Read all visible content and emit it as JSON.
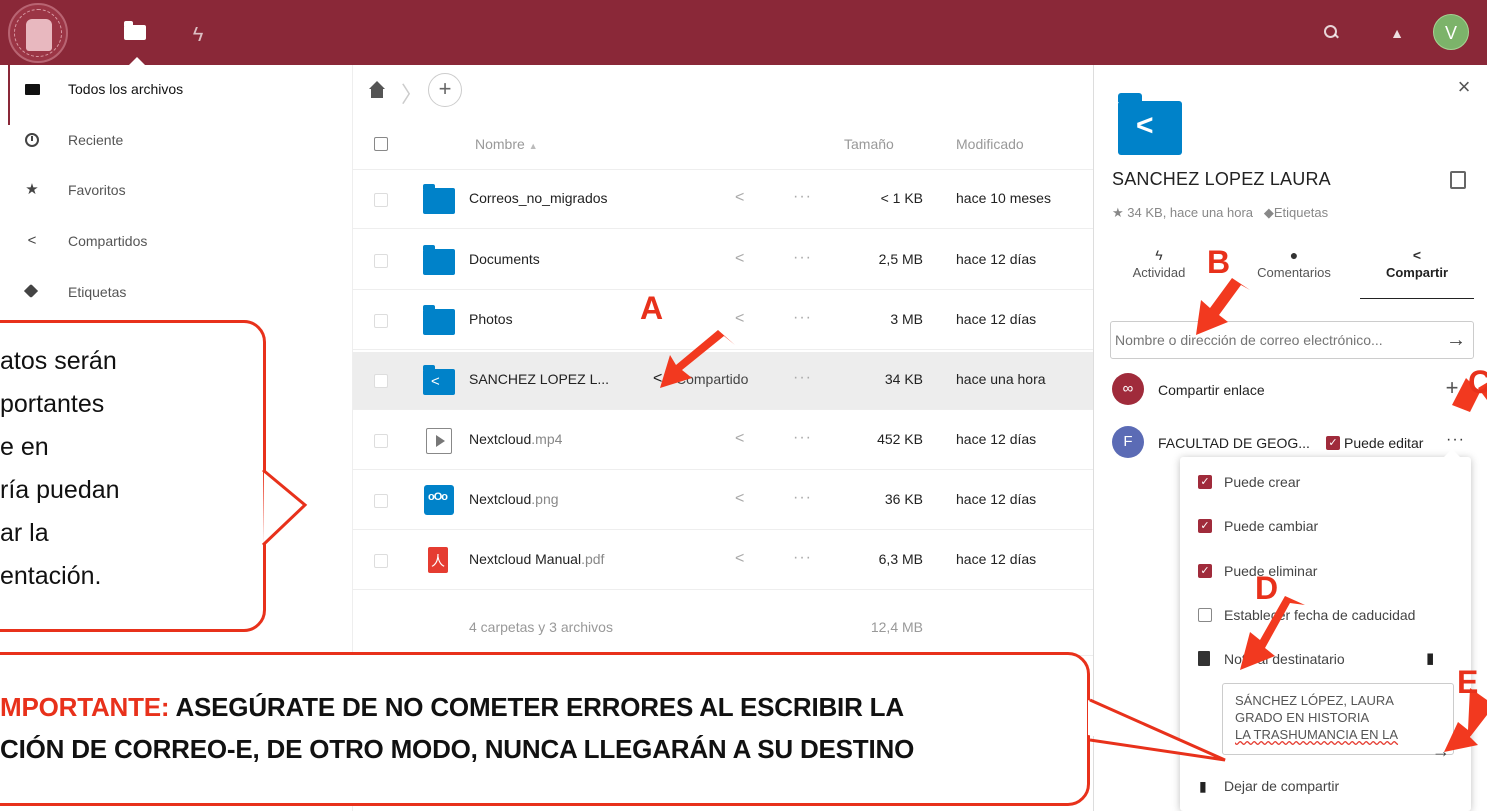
{
  "theme": {
    "brand": "#8a2838",
    "accent": "#0082c9",
    "annotation": "#e8311b"
  },
  "topbar": {
    "logo": "university-seal",
    "icons": [
      "files-folder-icon",
      "activity-bolt-icon",
      "search-icon",
      "bell-icon"
    ],
    "avatar_letter": "V"
  },
  "sidebar": {
    "items": [
      {
        "label": "Todos los archivos",
        "icon": "folder-icon"
      },
      {
        "label": "Reciente",
        "icon": "clock-icon"
      },
      {
        "label": "Favoritos",
        "icon": "star-icon"
      },
      {
        "label": "Compartidos",
        "icon": "share-icon"
      },
      {
        "label": "Etiquetas",
        "icon": "tag-icon"
      }
    ]
  },
  "list": {
    "headers": {
      "name": "Nombre",
      "sort": "▲",
      "size": "Tamaño",
      "modified": "Modificado"
    },
    "rows": [
      {
        "name": "Correos_no_migrados",
        "ext": "",
        "icon": "folder",
        "size": "< 1 KB",
        "modified": "hace 10 meses"
      },
      {
        "name": "Documents",
        "ext": "",
        "icon": "folder",
        "size": "2,5 MB",
        "modified": "hace 12 días"
      },
      {
        "name": "Photos",
        "ext": "",
        "icon": "folder",
        "size": "3 MB",
        "modified": "hace 12 días"
      },
      {
        "name": "SANCHEZ LOPEZ L...",
        "ext": "",
        "icon": "shared-folder",
        "size": "34 KB",
        "modified": "hace una hora",
        "share_label": "Compartido"
      },
      {
        "name": "Nextcloud",
        "ext": ".mp4",
        "icon": "video",
        "size": "452 KB",
        "modified": "hace 12 días"
      },
      {
        "name": "Nextcloud",
        "ext": ".png",
        "icon": "image",
        "size": "36 KB",
        "modified": "hace 12 días"
      },
      {
        "name": "Nextcloud Manual",
        "ext": ".pdf",
        "icon": "pdf",
        "size": "6,3 MB",
        "modified": "hace 12 días"
      }
    ],
    "summary": {
      "text": "4 carpetas y 3 archivos",
      "total": "12,4 MB"
    }
  },
  "panel": {
    "title": "SANCHEZ LOPEZ LAURA",
    "meta": "34 KB, hace una hora",
    "tags_label": "Etiquetas",
    "tabs": [
      {
        "label": "Actividad",
        "icon": "bolt-icon"
      },
      {
        "label": "Comentarios",
        "icon": "comment-icon"
      },
      {
        "label": "Compartir",
        "icon": "share-icon"
      }
    ],
    "share_input_placeholder": "Nombre o dirección de correo electrónico...",
    "share_link_label": "Compartir enlace",
    "recipient": {
      "initial": "F",
      "name": "FACULTAD DE GEOG...",
      "permission": "Puede editar"
    },
    "menu": {
      "items": [
        {
          "label": "Puede crear",
          "checked": true
        },
        {
          "label": "Puede cambiar",
          "checked": true
        },
        {
          "label": "Puede eliminar",
          "checked": true
        },
        {
          "label": "Establecer fecha de caducidad",
          "checked": false
        }
      ],
      "note_label": "Nota al destinatario",
      "note_lines": [
        "SÁNCHEZ LÓPEZ, LAURA",
        "GRADO EN HISTORIA",
        "LA TRASHUMANCIA EN LA"
      ],
      "unshare_label": "Dejar de compartir"
    }
  },
  "annotations": {
    "callout_lines": [
      "atos serán",
      "portantes",
      "e en",
      "ría puedan",
      "ar la",
      "entación."
    ],
    "notice_prefix": "MPORTANTE:",
    "notice_line1": " ASEGÚRATE DE NO COMETER ERRORES AL ESCRIBIR LA",
    "notice_line2": "CIÓN DE CORREO-E, DE OTRO MODO, NUNCA LLEGARÁN A SU DESTINO",
    "labels": {
      "a": "A",
      "b": "B",
      "c": "C",
      "d": "D",
      "e": "E"
    }
  }
}
